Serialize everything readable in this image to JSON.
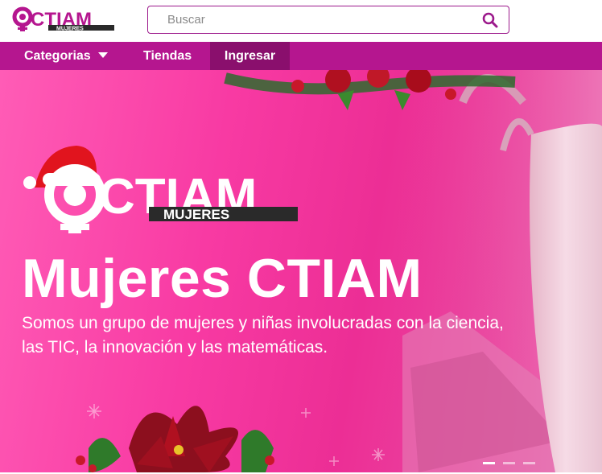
{
  "brand": {
    "logo_text": "CTIAM",
    "logo_sub": "MUJERES",
    "logo_letter": "Q"
  },
  "search": {
    "placeholder": "Buscar",
    "value": "",
    "icon": "search-icon"
  },
  "nav": {
    "items": [
      {
        "label": "Categorias",
        "icon": "chevron-down-icon"
      },
      {
        "label": "Tiendas"
      },
      {
        "label": "Ingresar"
      }
    ]
  },
  "hero": {
    "logo_text": "CTIAM",
    "logo_sub": "MUJERES",
    "title": "Mujeres CTIAM",
    "line1": "Somos un grupo de mujeres y niñas involucradas con la ciencia,",
    "line2": "las TIC, la innovación y las matemáticas.",
    "slides": {
      "count": 3,
      "active": 1
    }
  },
  "colors": {
    "brand": "#b5168f",
    "nav_active": "#8a0f6d",
    "hero_pink": "#f83aa3",
    "border": "#9c1a8c"
  }
}
